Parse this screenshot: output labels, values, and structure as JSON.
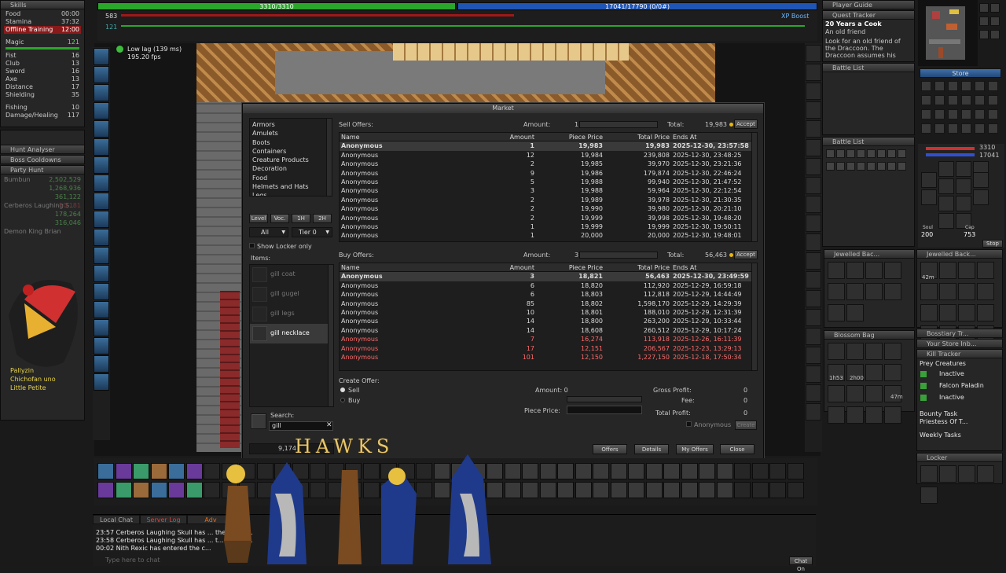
{
  "skills": {
    "title": "Skills",
    "rows": [
      {
        "label": "Food",
        "value": "00:00"
      },
      {
        "label": "Stamina",
        "value": "37:32"
      },
      {
        "label": "Offline Training",
        "value": "12:00"
      },
      {
        "label": "Magic",
        "value": "121"
      },
      {
        "label": "Fist",
        "value": "16"
      },
      {
        "label": "Club",
        "value": "13"
      },
      {
        "label": "Sword",
        "value": "16"
      },
      {
        "label": "Axe",
        "value": "13"
      },
      {
        "label": "Distance",
        "value": "17"
      },
      {
        "label": "Shielding",
        "value": "35"
      },
      {
        "label": "Fishing",
        "value": "10"
      },
      {
        "label": "Damage/Healing",
        "value": "117"
      }
    ]
  },
  "hunt": {
    "title": "Hunt Analyser"
  },
  "boss": {
    "title": "Boss Cooldowns"
  },
  "party": {
    "title": "Party Hunt",
    "members": [
      {
        "name": "Bumbun",
        "value": "2,502,529"
      },
      {
        "name": "",
        "value": "1,268,936"
      },
      {
        "name": "",
        "value": "361,122"
      },
      {
        "name": "Cerberos Laughing S...",
        "value": "-50,181"
      },
      {
        "name": "",
        "value": "178,264"
      },
      {
        "name": "",
        "value": "316,046"
      },
      {
        "name": "Demon King Brian",
        "value": ""
      }
    ],
    "list": [
      "Pallyzin",
      "Chichofan uno",
      "Little Petite"
    ]
  },
  "top": {
    "hp": "3310/3310",
    "mana": "17041/17790 (0/0#)",
    "hp_small": "583",
    "mana_small": "121",
    "xp_boost": "XP Boost"
  },
  "status": {
    "lag": "Low lag (139 ms)",
    "fps": "195.20 fps"
  },
  "market": {
    "title": "Market",
    "categories": [
      "Armors",
      "Amulets",
      "Boots",
      "Containers",
      "Creature Products",
      "Decoration",
      "Food",
      "Helmets and Hats",
      "Legs"
    ],
    "filters": {
      "level": "Level",
      "voc": "Voc.",
      "h1": "1H",
      "h2": "2H",
      "all": "All",
      "tier": "Tier 0",
      "show_locker": "Show Locker only",
      "items_label": "Items:"
    },
    "items": [
      "gill coat",
      "gill gugel",
      "gill legs",
      "gill necklace"
    ],
    "search_label": "Search:",
    "search_value": "gill",
    "sell": {
      "label": "Sell Offers:",
      "amount_label": "Amount:",
      "amount": "1",
      "total_label": "Total:",
      "total": "19,983",
      "accept": "Accept"
    },
    "buy": {
      "label": "Buy Offers:",
      "amount_label": "Amount:",
      "amount": "3",
      "total_label": "Total:",
      "total": "56,463",
      "accept": "Accept"
    },
    "columns": [
      "Name",
      "Amount",
      "Piece Price",
      "Total Price",
      "Ends At"
    ],
    "sell_rows": [
      [
        "Anonymous",
        "1",
        "19,983",
        "19,983",
        "2025-12-30, 23:57:58"
      ],
      [
        "Anonymous",
        "12",
        "19,984",
        "239,808",
        "2025-12-30, 23:48:25"
      ],
      [
        "Anonymous",
        "2",
        "19,985",
        "39,970",
        "2025-12-30, 23:21:36"
      ],
      [
        "Anonymous",
        "9",
        "19,986",
        "179,874",
        "2025-12-30, 22:46:24"
      ],
      [
        "Anonymous",
        "5",
        "19,988",
        "99,940",
        "2025-12-30, 21:47:52"
      ],
      [
        "Anonymous",
        "3",
        "19,988",
        "59,964",
        "2025-12-30, 22:12:54"
      ],
      [
        "Anonymous",
        "2",
        "19,989",
        "39,978",
        "2025-12-30, 21:30:35"
      ],
      [
        "Anonymous",
        "2",
        "19,990",
        "39,980",
        "2025-12-30, 20:21:10"
      ],
      [
        "Anonymous",
        "2",
        "19,999",
        "39,998",
        "2025-12-30, 19:48:20"
      ],
      [
        "Anonymous",
        "1",
        "19,999",
        "19,999",
        "2025-12-30, 19:50:11"
      ],
      [
        "Anonymous",
        "1",
        "20,000",
        "20,000",
        "2025-12-30, 19:48:01"
      ]
    ],
    "buy_rows": [
      [
        "Anonymous",
        "3",
        "18,821",
        "56,463",
        "2025-12-30, 23:49:59"
      ],
      [
        "Anonymous",
        "6",
        "18,820",
        "112,920",
        "2025-12-29, 16:59:18"
      ],
      [
        "Anonymous",
        "6",
        "18,803",
        "112,818",
        "2025-12-29, 14:44:49"
      ],
      [
        "Anonymous",
        "85",
        "18,802",
        "1,598,170",
        "2025-12-29, 14:29:39"
      ],
      [
        "Anonymous",
        "10",
        "18,801",
        "188,010",
        "2025-12-29, 12:31:39"
      ],
      [
        "Anonymous",
        "14",
        "18,800",
        "263,200",
        "2025-12-29, 10:33:44"
      ],
      [
        "Anonymous",
        "14",
        "18,608",
        "260,512",
        "2025-12-29, 10:17:24"
      ],
      [
        "Anonymous",
        "7",
        "16,274",
        "113,918",
        "2025-12-26, 16:11:39"
      ],
      [
        "Anonymous",
        "17",
        "12,151",
        "206,567",
        "2025-12-23, 13:29:13"
      ],
      [
        "Anonymous",
        "101",
        "12,150",
        "1,227,150",
        "2025-12-18, 17:50:34"
      ]
    ],
    "create": {
      "label": "Create Offer:",
      "sell": "Sell",
      "buy": "Buy",
      "amount": "Amount: 0",
      "piece_price": "Piece Price:",
      "gross": "Gross Profit:",
      "fee": "Fee:",
      "total_profit": "Total Profit:",
      "gross_v": "0",
      "fee_v": "0",
      "profit_v": "0",
      "anonymous": "Anonymous",
      "create": "Create"
    },
    "buttons": {
      "offers": "Offers",
      "details": "Details",
      "my_offers": "My Offers",
      "close": "Close"
    },
    "balance": "9,174"
  },
  "right": {
    "player_guide": "Player Guide",
    "quest_tracker": "Quest Tracker",
    "quest_title": "20 Years a Cook",
    "quest_sub": "An old friend",
    "quest_text": "Look for an old friend of the Draccoon. The Draccoon assumes his",
    "battle": "Battle List",
    "battle2": "Battle List",
    "store": "Store",
    "stats": {
      "hp": "3310",
      "mana": "17041",
      "soul": "200",
      "cap": "753",
      "stop": "Stop",
      "soul_label": "Soul",
      "cap_label": "Cap"
    },
    "jb1": "Jewelled Bac...",
    "jb2": "Jewelled Back...",
    "blossom": "Blossom Bag",
    "bosstiary": "Bosstiary Tr...",
    "your_store": "Your Store Inb...",
    "slot_counts": {
      "a": "42m",
      "b": "1h53",
      "c": "2h00",
      "d": "47m"
    },
    "kill": "Kill Tracker",
    "prey": "Prey Creatures",
    "prey_rows": [
      "Inactive",
      "Falcon Paladin",
      "Inactive"
    ],
    "bounty": "Bounty Task",
    "bounty_name": "Priestess Of T...",
    "weekly": "Weekly Tasks",
    "locker": "Locker"
  },
  "chat": {
    "tabs": [
      "Local Chat",
      "Server Log",
      "Adv"
    ],
    "lines": [
      "23:57 Cerberos Laughing Skull has ... the chann...",
      "23:58 Cerberos Laughing Skull has ... t... channel.",
      "00:02 Nith Rexic has entered the c..."
    ],
    "input": "Type here to chat",
    "chat_on": "Chat On",
    "hawks": "HAWKS"
  },
  "colors": {
    "accent": "#e7b60f",
    "hp": "#2aa72a",
    "mana": "#1f55b5",
    "sell_row": "#dcdcdc",
    "buy_red": "#ff6a6a"
  }
}
